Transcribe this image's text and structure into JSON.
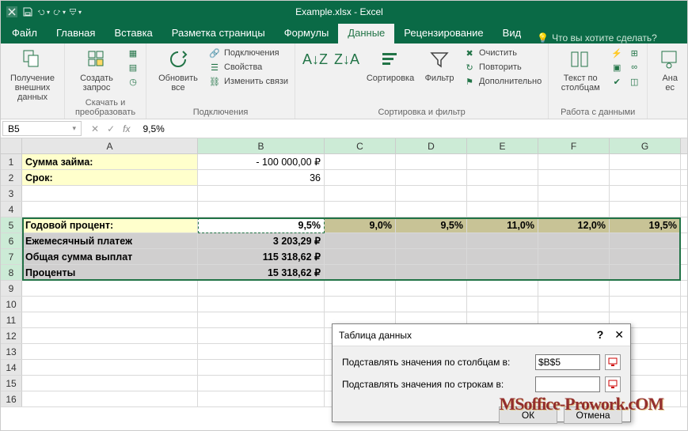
{
  "title": "Example.xlsx - Excel",
  "tabs": {
    "file": "Файл",
    "home": "Главная",
    "insert": "Вставка",
    "layout": "Разметка страницы",
    "formulas": "Формулы",
    "data": "Данные",
    "review": "Рецензирование",
    "view": "Вид",
    "tell": "Что вы хотите сделать?"
  },
  "ribbon": {
    "get_external": "Получение\nвнешних данных",
    "new_query": "Создать\nзапрос",
    "group_get_transform": "Скачать и преобразовать",
    "refresh_all": "Обновить\nвсе",
    "connections": "Подключения",
    "properties": "Свойства",
    "edit_links": "Изменить связи",
    "group_connections": "Подключения",
    "sort": "Сортировка",
    "filter": "Фильтр",
    "clear": "Очистить",
    "reapply": "Повторить",
    "advanced": "Дополнительно",
    "group_sort_filter": "Сортировка и фильтр",
    "text_to_cols": "Текст по\nстолбцам",
    "group_data_tools": "Работа с данными",
    "analysis": "Ана\nес"
  },
  "namebox": "B5",
  "formula": "9,5%",
  "columns": [
    "A",
    "B",
    "C",
    "D",
    "E",
    "F",
    "G"
  ],
  "rows": {
    "r1": {
      "A": "Сумма займа:",
      "B": "-       100 000,00 ₽"
    },
    "r2": {
      "A": "Срок:",
      "B": "36"
    },
    "r5": {
      "A": "Годовой процент:",
      "B": "9,5%",
      "C": "9,0%",
      "D": "9,5%",
      "E": "11,0%",
      "F": "12,0%",
      "G": "19,5%"
    },
    "r6": {
      "A": "Ежемесячный платеж",
      "B": "3 203,29 ₽"
    },
    "r7": {
      "A": "Общая сумма выплат",
      "B": "115 318,62 ₽"
    },
    "r8": {
      "A": "Проценты",
      "B": "15 318,62 ₽"
    }
  },
  "dialog": {
    "title": "Таблица данных",
    "col_label": "Подставлять значения по столбцам в:",
    "row_label": "Подставлять значения по строкам в:",
    "col_val": "$B$5",
    "row_val": "",
    "ok": "ОК",
    "cancel": "Отмена"
  },
  "watermark": "MSoffice-Prowork.cOM"
}
